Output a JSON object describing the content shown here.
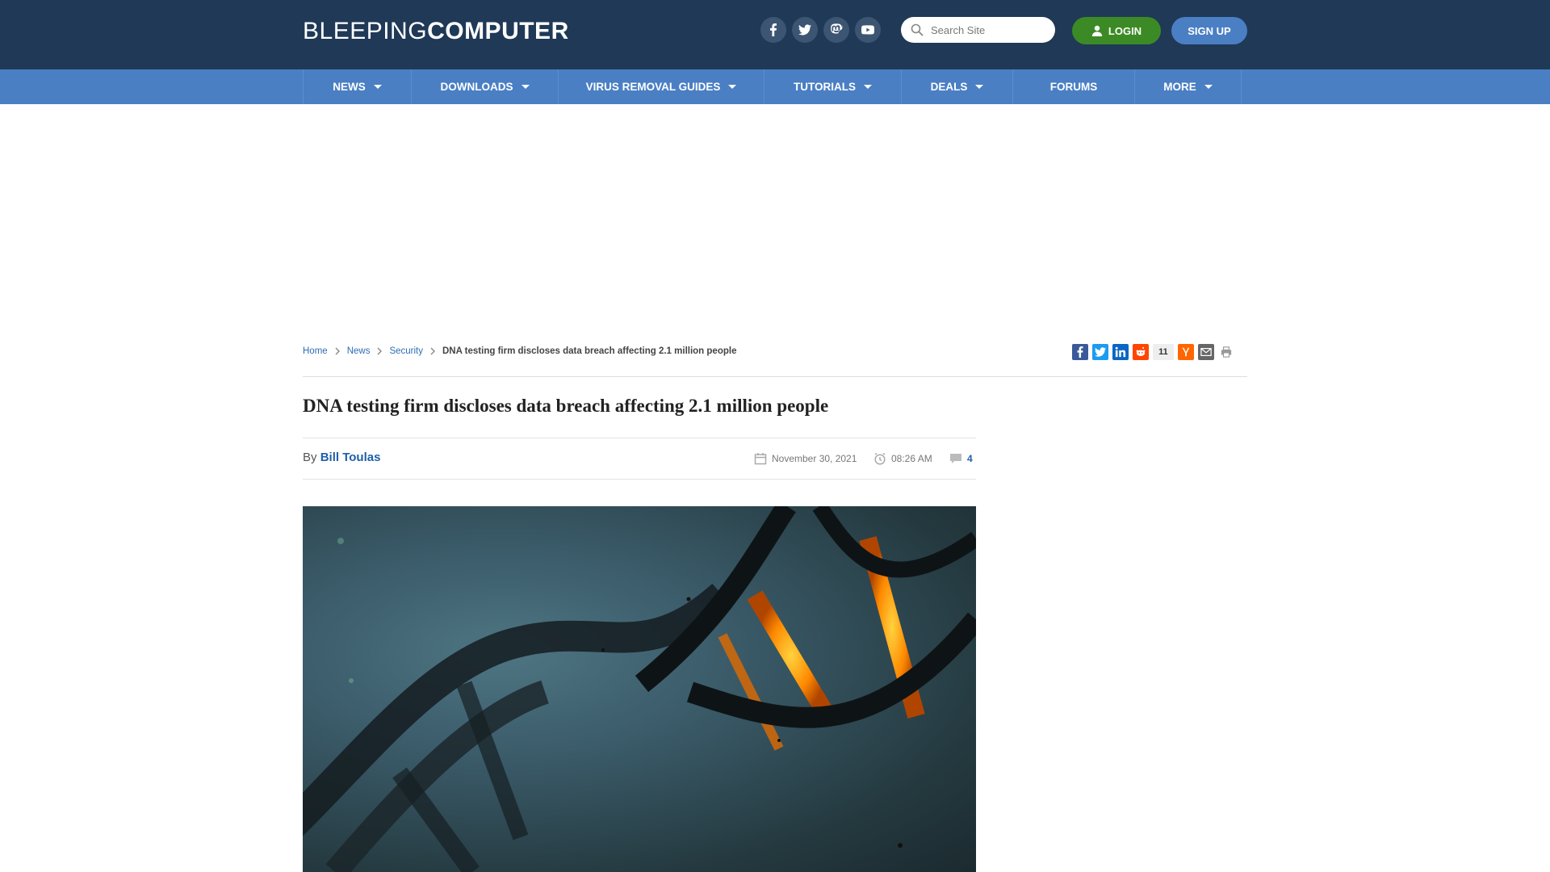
{
  "header": {
    "logo_light": "BLEEPING",
    "logo_bold": "COMPUTER",
    "socials": [
      "facebook-icon",
      "twitter-icon",
      "mastodon-icon",
      "youtube-icon"
    ],
    "search_placeholder": "Search Site",
    "login_label": "LOGIN",
    "signup_label": "SIGN UP",
    "colors": {
      "bar": "#1f3957",
      "login": "#3c8a25",
      "signup": "#4a7fc4"
    }
  },
  "nav": {
    "items": [
      {
        "label": "NEWS",
        "caret": true
      },
      {
        "label": "DOWNLOADS",
        "caret": true
      },
      {
        "label": "VIRUS REMOVAL GUIDES",
        "caret": true
      },
      {
        "label": "TUTORIALS",
        "caret": true
      },
      {
        "label": "DEALS",
        "caret": true
      },
      {
        "label": "FORUMS",
        "caret": false
      },
      {
        "label": "MORE",
        "caret": true
      }
    ]
  },
  "breadcrumb": {
    "home": "Home",
    "news": "News",
    "security": "Security",
    "current": "DNA testing firm discloses data breach affecting 2.1 million people"
  },
  "share": {
    "count": "11",
    "icons": [
      "facebook-icon",
      "twitter-icon",
      "linkedin-icon",
      "reddit-icon",
      "hackernews-icon",
      "email-icon",
      "print-icon"
    ]
  },
  "article": {
    "title": "DNA testing firm discloses data breach affecting 2.1 million people",
    "by": "By",
    "author": "Bill Toulas",
    "date": "November 30, 2021",
    "time": "08:26 AM",
    "comments": "4"
  }
}
